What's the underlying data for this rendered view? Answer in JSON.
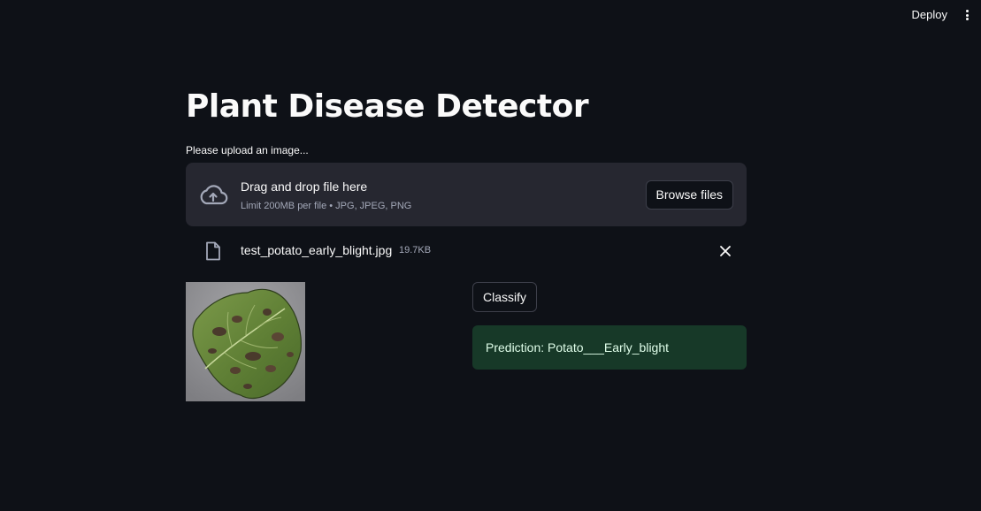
{
  "header": {
    "deploy_label": "Deploy",
    "menu_icon": "kebab-menu-icon"
  },
  "main": {
    "title": "Plant Disease Detector",
    "uploader": {
      "label": "Please upload an image...",
      "drop_title": "Drag and drop file here",
      "drop_limit": "Limit 200MB per file • JPG, JPEG, PNG",
      "browse_label": "Browse files",
      "icon": "cloud-upload-icon"
    },
    "file": {
      "name": "test_potato_early_blight.jpg",
      "size": "19.7KB",
      "icon": "file-icon",
      "remove_icon": "close-icon"
    },
    "classify_label": "Classify",
    "prediction_text": "Prediction: Potato___Early_blight"
  },
  "colors": {
    "background": "#0e1117",
    "surface": "#262730",
    "success_bg": "#173928",
    "success_text": "#dffde9"
  }
}
